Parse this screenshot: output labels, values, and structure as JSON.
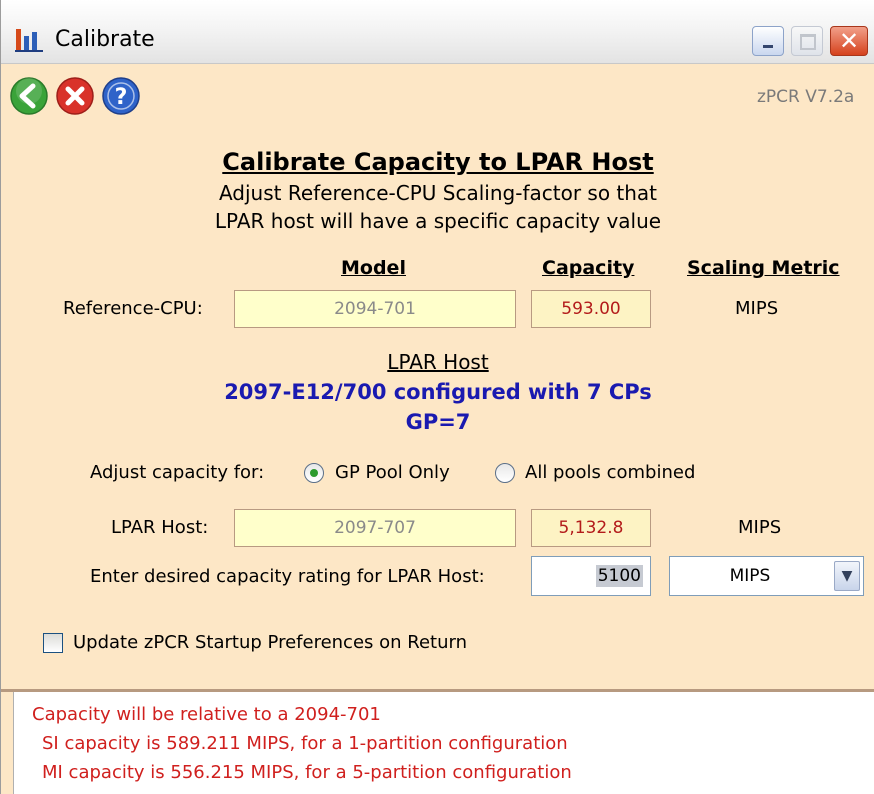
{
  "window": {
    "title": "Calibrate",
    "icon": "bar-chart-icon"
  },
  "toolbar": {
    "back_icon": "green-back-arrow-icon",
    "cancel_icon": "red-x-icon",
    "help_icon": "help-question-icon",
    "version": "zPCR V7.2a"
  },
  "heading": {
    "title": "Calibrate Capacity to LPAR Host",
    "line1": "Adjust Reference-CPU Scaling-factor so that",
    "line2": "LPAR host will have a specific capacity value"
  },
  "columns": {
    "model": "Model",
    "capacity": "Capacity",
    "metric": "Scaling Metric"
  },
  "reference": {
    "label": "Reference-CPU:",
    "model": "2094-701",
    "capacity": "593.00",
    "metric": "MIPS"
  },
  "lpar": {
    "title": "LPAR Host",
    "config": "2097-E12/700 configured with 7 CPs",
    "pool": "GP=7"
  },
  "adjust": {
    "label": "Adjust capacity for:",
    "option1": "GP Pool Only",
    "option2": "All pools combined",
    "selected": "GP Pool Only"
  },
  "lpar_host": {
    "label": "LPAR Host:",
    "model": "2097-707",
    "capacity": "5,132.8",
    "metric": "MIPS"
  },
  "desired": {
    "label": "Enter desired capacity rating for LPAR Host:",
    "value": "5100",
    "unit": "MIPS"
  },
  "preferences": {
    "label": "Update zPCR Startup Preferences on Return",
    "checked": false
  },
  "messages": [
    "Capacity will be relative to a 2094-701",
    "SI capacity is 589.211 MIPS, for a 1-partition configuration",
    "MI capacity is 556.215 MIPS, for a 5-partition configuration"
  ],
  "colors": {
    "background": "#fde7c6",
    "accent_red": "#d0201e",
    "lpar_blue": "#1a1ab0"
  }
}
